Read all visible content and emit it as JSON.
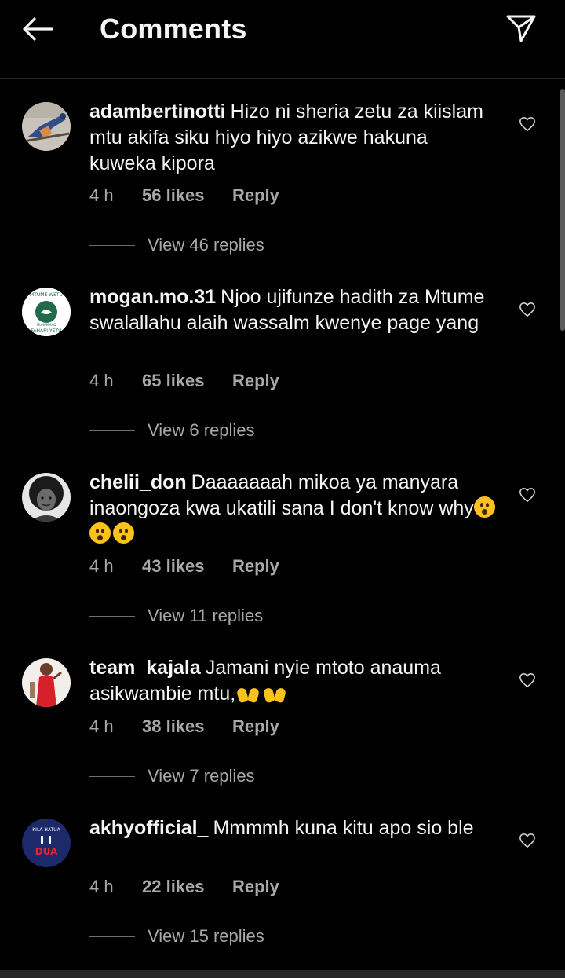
{
  "header": {
    "title": "Comments",
    "back_icon": "arrow-left-icon",
    "send_icon": "paper-plane-icon"
  },
  "colors": {
    "background": "#000000",
    "text": "#f5f5f5",
    "muted": "#a8a8a8",
    "divider": "#262626"
  },
  "comments": [
    {
      "username": "adambertinotti",
      "text": "Hizo ni sheria zetu za kiislam mtu akifa siku hiyo hiyo azikwe hakuna kuweka kipora",
      "time": "4 h",
      "likes": "56 likes",
      "reply_label": "Reply",
      "view_replies": "View 46 replies"
    },
    {
      "username": "mogan.mo.31",
      "text": "Njoo ujifunze hadith za Mtume swalallahu alaih wassalm kwenye page yang",
      "time": "4 h",
      "likes": "65 likes",
      "reply_label": "Reply",
      "view_replies": "View 6 replies",
      "avatar_text": {
        "top": "MTUME WETU",
        "middle": "MUHAMMAD",
        "bottom": "FAHARI YETU"
      }
    },
    {
      "username": "chelii_don",
      "text": "Daaaaaaah mikoa ya manyara inaongoza kwa ukatili sana I don't know why",
      "time": "4 h",
      "likes": "43 likes",
      "reply_label": "Reply",
      "view_replies": "View 11 replies"
    },
    {
      "username": "team_kajala",
      "text": "Jamani nyie mtoto anauma asikwambie mtu,",
      "time": "4 h",
      "likes": "38 likes",
      "reply_label": "Reply",
      "view_replies": "View 7 replies"
    },
    {
      "username": "akhyofficial_",
      "text": "Mmmmh kuna kitu apo sio ble",
      "time": "4 h",
      "likes": "22 likes",
      "reply_label": "Reply",
      "view_replies": "View 15 replies",
      "avatar_text": {
        "top": "KILA HATUA",
        "bottom": "DUA"
      }
    }
  ]
}
